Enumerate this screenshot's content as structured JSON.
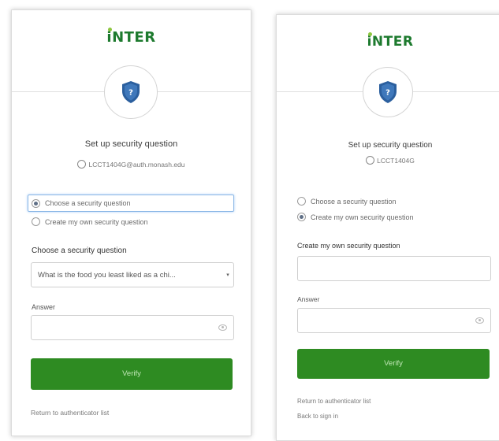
{
  "brand": {
    "logo_first": "i",
    "logo_rest": "NTER",
    "color": "#1d7a2e",
    "dot_color": "#8dc63f"
  },
  "left_card": {
    "title": "Set up security question",
    "user": "LCCT1404G@auth.monash.edu",
    "radio_options": [
      {
        "label": "Choose a security question",
        "selected": true
      },
      {
        "label": "Create my own security question",
        "selected": false
      }
    ],
    "select_label": "Choose a security question",
    "select_value": "What is the food you least liked as a chi...",
    "answer_label": "Answer",
    "answer_value": "",
    "verify_label": "Verify",
    "return_link": "Return to authenticator list"
  },
  "right_card": {
    "title": "Set up security question",
    "user": "LCCT1404G",
    "radio_options": [
      {
        "label": "Choose a security question",
        "selected": false
      },
      {
        "label": "Create my own security question",
        "selected": true
      }
    ],
    "own_question_label": "Create my own security question",
    "own_question_value": "",
    "answer_label": "Answer",
    "answer_value": "",
    "verify_label": "Verify",
    "return_link": "Return to authenticator list",
    "back_link": "Back to sign in"
  },
  "icons": {
    "shield": "shield-question-icon",
    "user": "user-circle-icon",
    "eye": "eye-icon",
    "select_arrow": "caret-down-icon"
  },
  "colors": {
    "button": "#2e8b22",
    "shield": "#2b5f9e",
    "focus": "#8bb7e6"
  }
}
